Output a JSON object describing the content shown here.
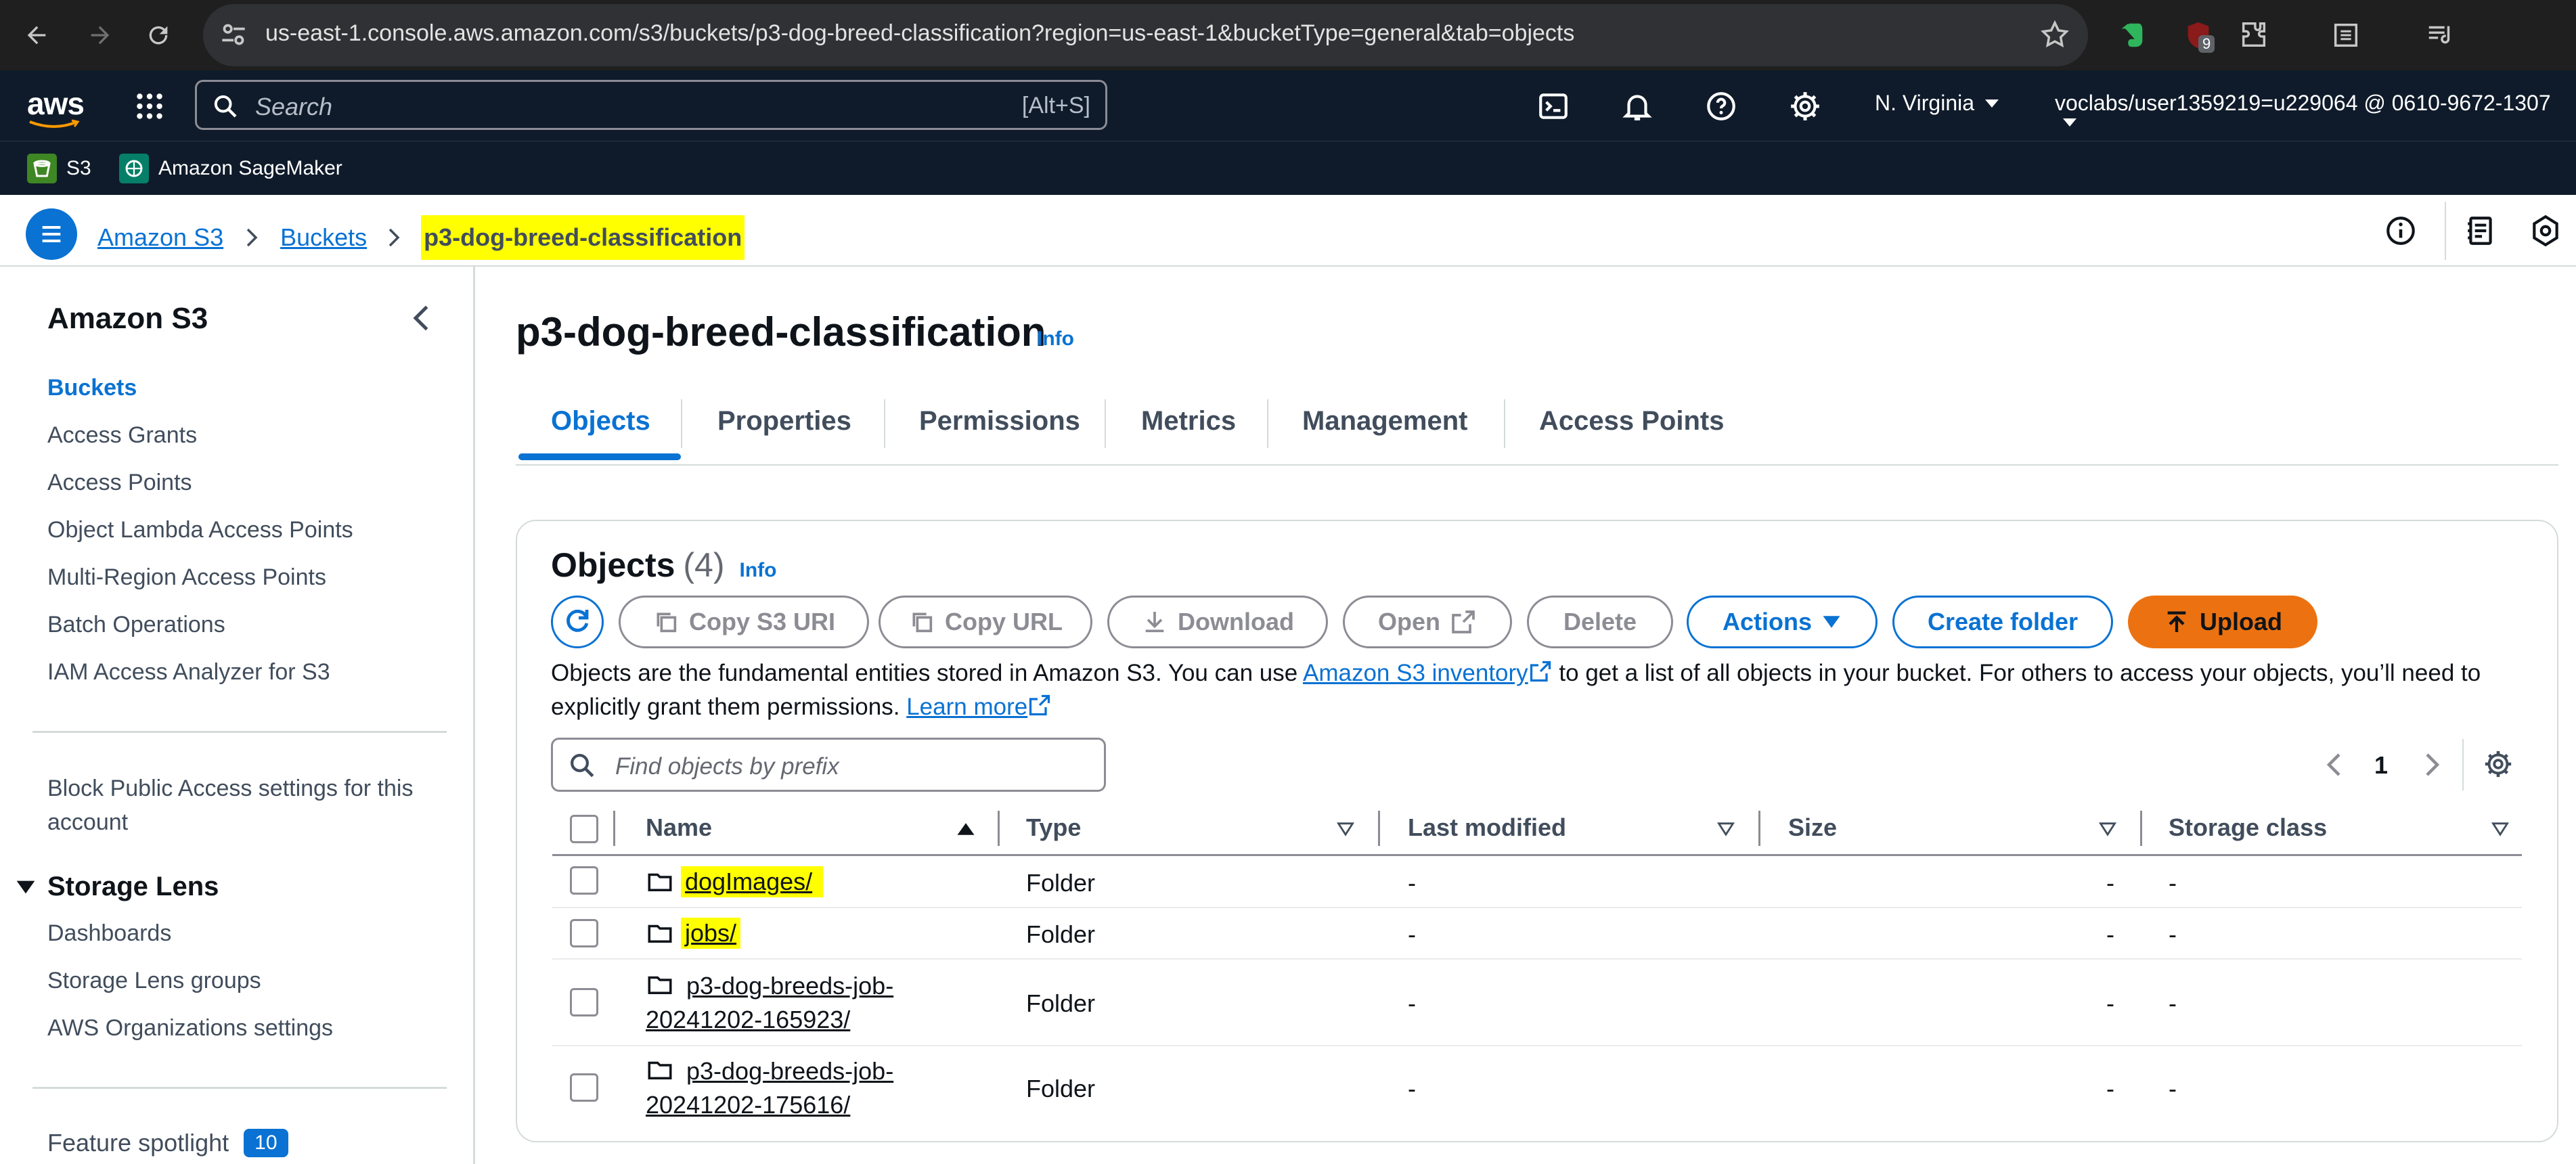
{
  "browser": {
    "url": "us-east-1.console.aws.amazon.com/s3/buckets/p3-dog-breed-classification?region=us-east-1&bucketType=general&tab=objects",
    "extension_badge": "9"
  },
  "aws_header": {
    "logo": "aws",
    "search_placeholder": "Search",
    "search_shortcut": "[Alt+S]",
    "region": "N. Virginia",
    "account": "voclabs/user1359219=u229064 @ 0610-9672-1307"
  },
  "favorites": [
    {
      "label": "S3"
    },
    {
      "label": "Amazon SageMaker"
    }
  ],
  "breadcrumb": {
    "items": [
      "Amazon S3",
      "Buckets"
    ],
    "current": "p3-dog-breed-classification"
  },
  "sidebar": {
    "title": "Amazon S3",
    "items": [
      "Buckets",
      "Access Grants",
      "Access Points",
      "Object Lambda Access Points",
      "Multi-Region Access Points",
      "Batch Operations",
      "IAM Access Analyzer for S3"
    ],
    "block_public_access": "Block Public Access settings for this account",
    "storage_lens": {
      "title": "Storage Lens",
      "items": [
        "Dashboards",
        "Storage Lens groups",
        "AWS Organizations settings"
      ]
    },
    "feature_spotlight": {
      "label": "Feature spotlight",
      "count": "10"
    }
  },
  "page": {
    "title": "p3-dog-breed-classification",
    "info": "Info",
    "tabs": [
      "Objects",
      "Properties",
      "Permissions",
      "Metrics",
      "Management",
      "Access Points"
    ]
  },
  "objects": {
    "title": "Objects",
    "count": "(4)",
    "info": "Info",
    "buttons": {
      "copy_s3_uri": "Copy S3 URI",
      "copy_url": "Copy URL",
      "download": "Download",
      "open": "Open",
      "delete": "Delete",
      "actions": "Actions",
      "create_folder": "Create folder",
      "upload": "Upload"
    },
    "description_1": "Objects are the fundamental entities stored in Amazon S3. You can use",
    "inventory_link": "Amazon S3 inventory",
    "description_2": "to get a list of all objects in your bucket. For others to access your objects, you’ll need",
    "description_3": "to explicitly grant them permissions.",
    "learn_more": "Learn more",
    "filter_placeholder": "Find objects by prefix",
    "page_number": "1",
    "columns": [
      "Name",
      "Type",
      "Last modified",
      "Size",
      "Storage class"
    ],
    "rows": [
      {
        "name": "dogImages/",
        "type": "Folder",
        "last_modified": "-",
        "size": "-",
        "storage_class": "-"
      },
      {
        "name": "jobs/",
        "type": "Folder",
        "last_modified": "-",
        "size": "-",
        "storage_class": "-"
      },
      {
        "name_line1": "p3-dog-breeds-job-",
        "name_line2": "20241202-165923/",
        "type": "Folder",
        "last_modified": "-",
        "size": "-",
        "storage_class": "-"
      },
      {
        "name_line1": "p3-dog-breeds-job-",
        "name_line2": "20241202-175616/",
        "type": "Folder",
        "last_modified": "-",
        "size": "-",
        "storage_class": "-"
      }
    ]
  },
  "colors": {
    "link": "#0972d3",
    "upload_button": "#ec7211",
    "highlight": "#ffff00",
    "aws_header_bg": "#0f1b2a"
  }
}
